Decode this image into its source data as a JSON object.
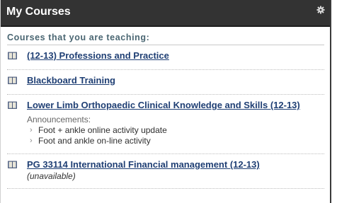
{
  "panel": {
    "title": "My Courses",
    "settings_icon": "gear-icon"
  },
  "section": {
    "label": "Courses that you are teaching:"
  },
  "courses": [
    {
      "name": "(12-13) Professions and Practice",
      "icon": "book-icon"
    },
    {
      "name": "Blackboard Training",
      "icon": "book-icon"
    },
    {
      "name": "Lower Limb Orthopaedic Clinical Knowledge and Skills (12-13)",
      "icon": "book-icon",
      "announcements_label": "Announcements:",
      "announcements": [
        "Foot + ankle online activity update",
        "Foot and ankle on-line activity"
      ]
    },
    {
      "name": "PG 33114 International Financial management (12-13)",
      "icon": "book-icon",
      "status": "(unavailable)"
    }
  ],
  "colors": {
    "header_bg": "#333333",
    "link": "#1f3f74",
    "section_label": "#4a6672"
  }
}
